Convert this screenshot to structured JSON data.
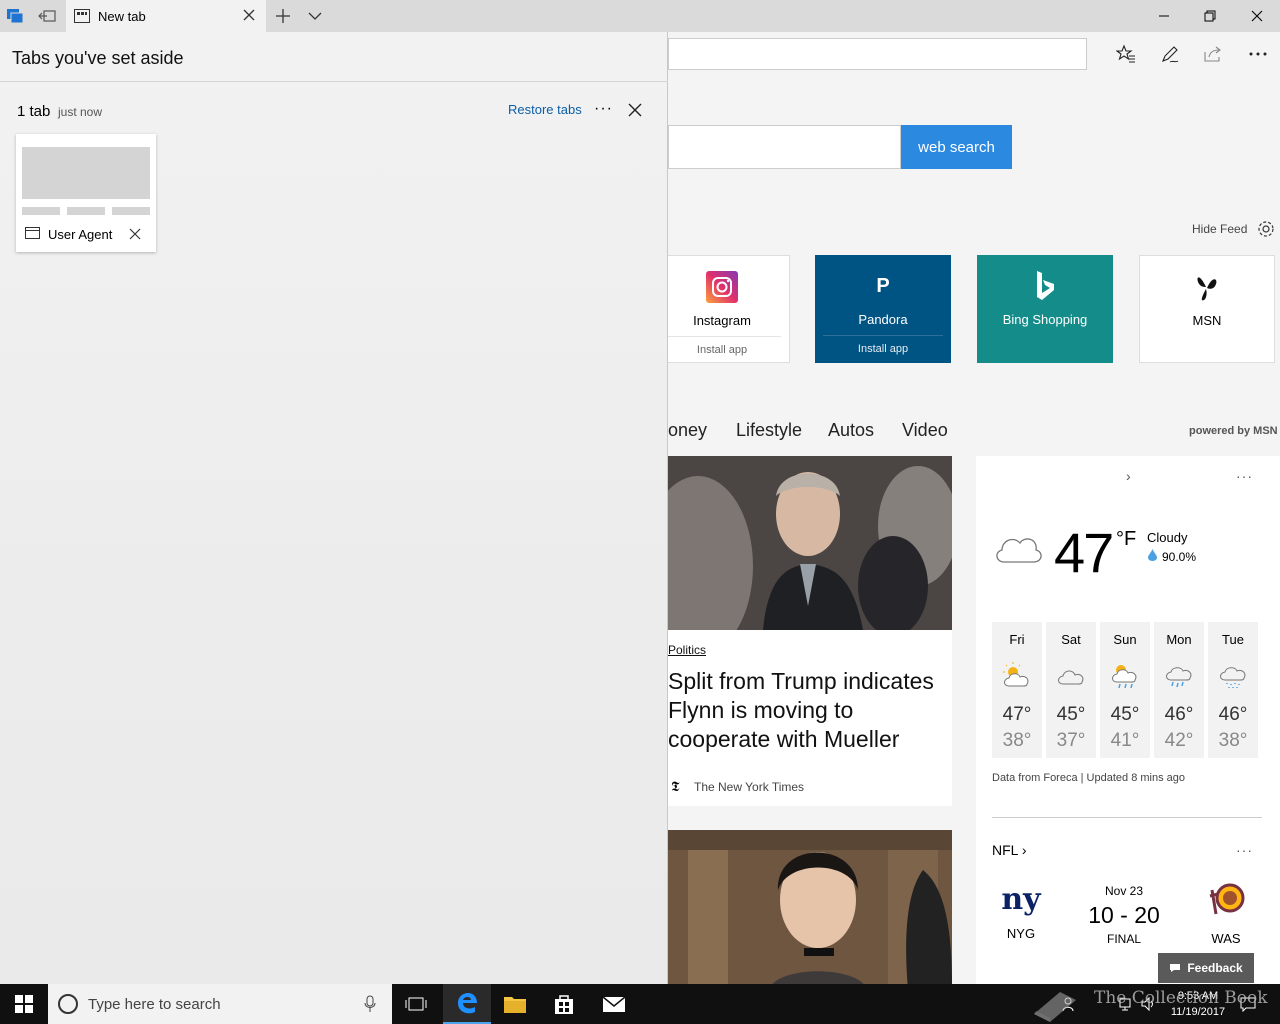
{
  "browser": {
    "tab_title": "New tab",
    "toolbar_icons": [
      "favorites-icon",
      "pen-icon",
      "share-icon",
      "more-icon"
    ]
  },
  "aside": {
    "title": "Tabs you've set aside",
    "group_count": "1 tab",
    "group_time": "just now",
    "restore_label": "Restore tabs",
    "more_label": "···",
    "saved_tab_title": "User Agent"
  },
  "page": {
    "search_button": "web search",
    "hide_feed": "Hide Feed",
    "tiles": [
      {
        "name": "Instagram",
        "install": "Install app"
      },
      {
        "name": "Pandora",
        "install": "Install app",
        "letter": "P"
      },
      {
        "name": "Bing Shopping"
      },
      {
        "name": "MSN"
      }
    ],
    "categories": [
      "oney",
      "Lifestyle",
      "Autos",
      "Video"
    ],
    "powered_by": "powered by MSN",
    "news": {
      "category": "Politics",
      "headline": "Split from Trump indicates Flynn is moving to cooperate with Mueller",
      "source": "The New York Times",
      "source_icon": "𝕿"
    },
    "weather": {
      "temp": "47",
      "unit": "°F",
      "condition": "Cloudy",
      "humidity": "90.0%",
      "chevron": "›",
      "more": "···",
      "forecast": [
        {
          "day": "Fri",
          "hi": "47°",
          "lo": "38°",
          "icon": "partly-sunny-icon"
        },
        {
          "day": "Sat",
          "hi": "45°",
          "lo": "37°",
          "icon": "cloudy-icon"
        },
        {
          "day": "Sun",
          "hi": "45°",
          "lo": "41°",
          "icon": "sun-rain-icon"
        },
        {
          "day": "Mon",
          "hi": "46°",
          "lo": "42°",
          "icon": "rain-icon"
        },
        {
          "day": "Tue",
          "hi": "46°",
          "lo": "38°",
          "icon": "drizzle-icon"
        }
      ],
      "footer": "Data from Foreca | Updated 8 mins ago"
    },
    "nfl": {
      "title": "NFL ›",
      "more": "···",
      "home": "NYG",
      "home_logo": "ny",
      "away": "WAS",
      "date": "Nov 23",
      "score": "10 - 20",
      "status": "FINAL"
    },
    "feedback": "Feedback"
  },
  "taskbar": {
    "search_placeholder": "Type here to search",
    "time": "9:53 AM",
    "date": "11/19/2017",
    "watermark": "The Collection Book"
  }
}
